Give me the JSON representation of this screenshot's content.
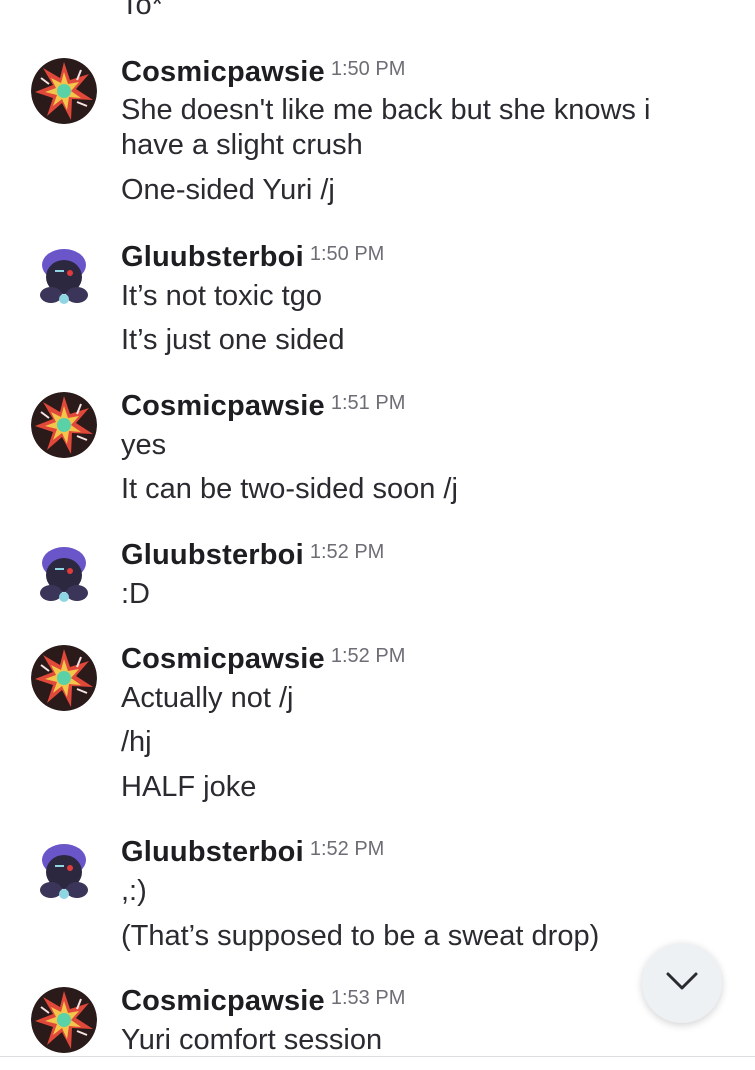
{
  "previous_fragment": "To*",
  "groups": [
    {
      "username": "Cosmicpawsie",
      "time": "1:50 PM",
      "avatar": "cosmicpawsie-avatar",
      "messages": [
        "She doesn't like me back but she knows i have a slight crush",
        "One-sided Yuri /j"
      ]
    },
    {
      "username": "Gluubsterboi",
      "time": "1:50 PM",
      "avatar": "gluubsterboi-avatar",
      "messages": [
        "It’s not toxic tgo",
        "It’s just one sided"
      ]
    },
    {
      "username": "Cosmicpawsie",
      "time": "1:51 PM",
      "avatar": "cosmicpawsie-avatar",
      "messages": [
        "yes",
        "It can be two-sided soon /j"
      ]
    },
    {
      "username": "Gluubsterboi",
      "time": "1:52 PM",
      "avatar": "gluubsterboi-avatar",
      "messages": [
        ":D"
      ]
    },
    {
      "username": "Cosmicpawsie",
      "time": "1:52 PM",
      "avatar": "cosmicpawsie-avatar",
      "messages": [
        "Actually not /j",
        "/hj",
        "HALF joke"
      ]
    },
    {
      "username": "Gluubsterboi",
      "time": "1:52 PM",
      "avatar": "gluubsterboi-avatar",
      "messages": [
        ",:)",
        "(That’s supposed to be a sweat drop)"
      ]
    },
    {
      "username": "Cosmicpawsie",
      "time": "1:53 PM",
      "avatar": "cosmicpawsie-avatar",
      "messages": [
        "Yuri comfort session"
      ]
    }
  ],
  "jump_button_icon": "chevron-down-icon",
  "colors": {
    "username": "#1d1d22",
    "timestamp": "#6d6d75",
    "message": "#2a2a30",
    "jump_button_bg": "#eef1f4"
  }
}
